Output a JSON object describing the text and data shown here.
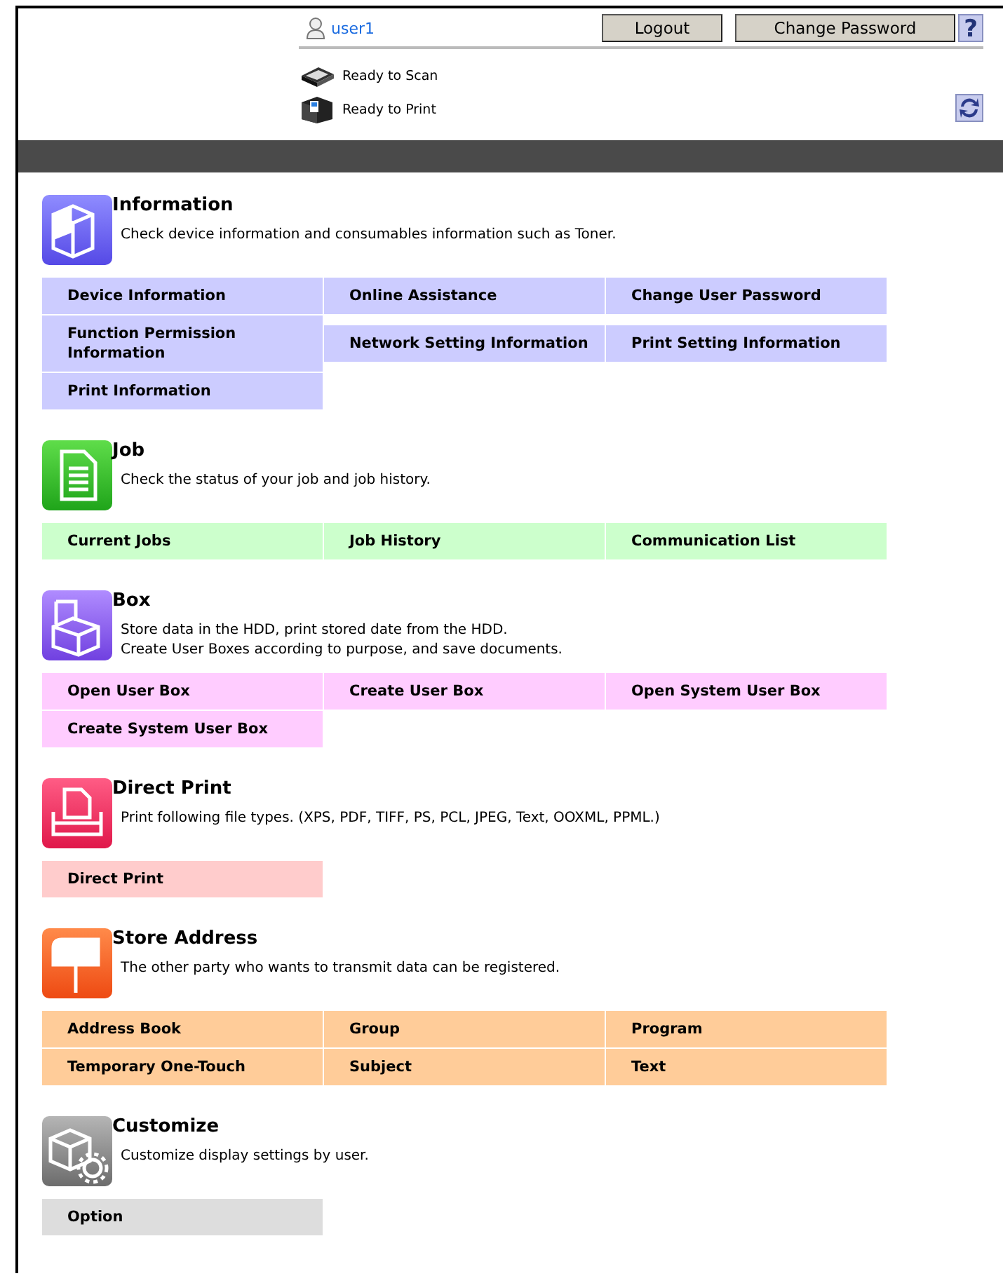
{
  "header": {
    "user": "user1",
    "buttons": [
      "Logout",
      "Change Password"
    ],
    "help": "?",
    "status": [
      {
        "kind": "scan",
        "text": "Ready to Scan"
      },
      {
        "kind": "print",
        "text": "Ready to Print"
      }
    ]
  },
  "sections": [
    {
      "kind": "information",
      "title": "Information",
      "description": [
        "Check device information and consumables information such as Toner."
      ],
      "links": [
        "Device Information",
        "Online Assistance",
        "Change User Password",
        "Function Permission Information",
        "Network Setting Information",
        "Print Setting Information",
        "Print Information"
      ]
    },
    {
      "kind": "job",
      "title": "Job",
      "description": [
        "Check the status of your job and job history."
      ],
      "links": [
        "Current Jobs",
        "Job History",
        "Communication List"
      ]
    },
    {
      "kind": "box",
      "title": "Box",
      "description": [
        "Store data in the HDD, print stored date from the HDD.",
        "Create User Boxes according to purpose, and save documents."
      ],
      "links": [
        "Open User Box",
        "Create User Box",
        "Open System User Box",
        "Create System User Box"
      ]
    },
    {
      "kind": "direct_print",
      "title": "Direct Print",
      "description": [
        "Print following file types. (XPS, PDF, TIFF, PS, PCL, JPEG, Text, OOXML, PPML.)"
      ],
      "links": [
        "Direct Print"
      ]
    },
    {
      "kind": "address",
      "title": "Store Address",
      "description": [
        "The other party who wants to transmit data can be registered."
      ],
      "links": [
        "Address Book",
        "Group",
        "Program",
        "Temporary One-Touch",
        "Subject",
        "Text"
      ]
    },
    {
      "kind": "customize",
      "title": "Customize",
      "description": [
        "Customize display settings by user."
      ],
      "links": [
        "Option"
      ]
    }
  ]
}
